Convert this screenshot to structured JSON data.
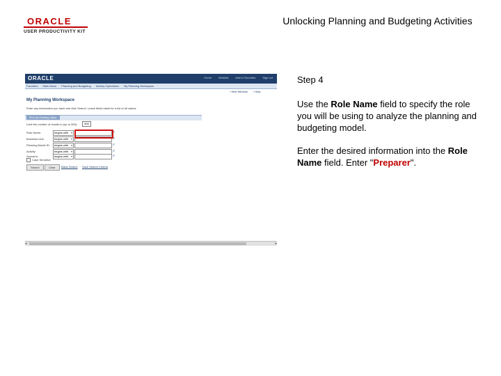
{
  "header": {
    "logo_mark": "ORACLE",
    "logo_sub": "USER PRODUCTIVITY KIT",
    "doc_title": "Unlocking Planning and Budgeting Activities"
  },
  "screenshot": {
    "brand": "ORACLE",
    "top_links": [
      "Home",
      "Worklist",
      "Add to Favorites",
      "Sign out"
    ],
    "nav_items": [
      "Favorites",
      "Main Menu",
      "Planning and Budgeting",
      "Activity Operations",
      "My Planning Workspace"
    ],
    "tools": [
      "New Window",
      "Help"
    ],
    "page_title": "My Planning Workspace",
    "instructions": "Enter any information you have and click Search. Leave fields blank for a list of all values.",
    "section_tab": "Find an Existing Value",
    "limit_label": "Limit the number of results to (up to 300):",
    "limit_value": "300",
    "fields": [
      {
        "label": "Role Name:",
        "operator": "begins with"
      },
      {
        "label": "Business Unit:",
        "operator": "begins with"
      },
      {
        "label": "Planning Model ID:",
        "operator": "begins with"
      },
      {
        "label": "Activity:",
        "operator": "begins with"
      },
      {
        "label": "Scenario:",
        "operator": "begins with"
      }
    ],
    "case_label": "Case Sensitive",
    "buttons": {
      "search": "Search",
      "clear": "Clear"
    },
    "links": {
      "basic": "Basic Search",
      "save": "Save Search Criteria"
    }
  },
  "panel": {
    "step": "Step 4",
    "p1_pre": "Use the ",
    "p1_field": "Role Name",
    "p1_post": " field to specify the role you will be using to analyze the planning and budgeting model.",
    "p2_pre": "Enter the desired information into the ",
    "p2_field": "Role Name",
    "p2_mid": " field. Enter \"",
    "p2_value": "Preparer",
    "p2_end": "\"."
  },
  "colors": {
    "accent_red": "#c00000",
    "brand_blue": "#1f3f6a",
    "highlight_red": "#d01010"
  }
}
